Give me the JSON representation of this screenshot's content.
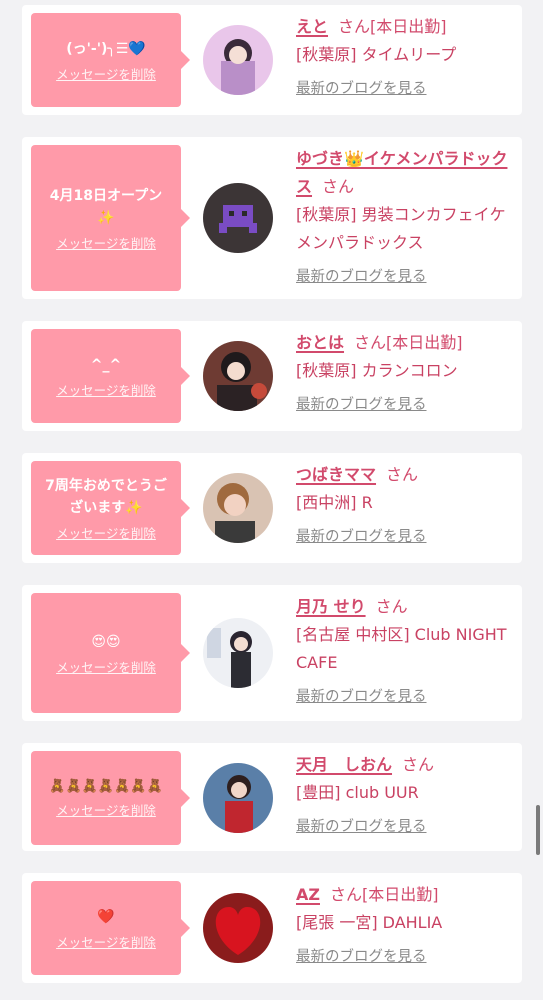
{
  "colors": {
    "accent": "#d24a6c",
    "bubble": "#ff9aa9",
    "link_gray": "#8a8a8a",
    "background": "#f2f2f4"
  },
  "delete_label": "メッセージを削除",
  "blog_label": "最新のブログを見る",
  "entries": [
    {
      "message": "(っ'-')╮☰💙",
      "name": "えと",
      "honor": "さん[本日出勤]",
      "shop": "[秋葉原] タイムリープ"
    },
    {
      "message": "4月18日オープン\n✨",
      "name": "ゆづき👑イケメンパラドックス",
      "honor": "さん",
      "shop": "[秋葉原] 男装コンカフェイケメンパラドックス"
    },
    {
      "message": "^_^",
      "name": "おとは",
      "honor": "さん[本日出勤]",
      "shop": "[秋葉原] カランコロン"
    },
    {
      "message": "7周年おめでとうございます✨",
      "name": "つばきママ",
      "honor": "さん",
      "shop": "[西中洲] R"
    },
    {
      "message": "😍😍",
      "name": "月乃 せり",
      "honor": "さん",
      "shop": "[名古屋 中村区] Club NIGHT CAFE"
    },
    {
      "message": "🧸🧸🧸🧸🧸🧸🧸",
      "name": "天月　しおん",
      "honor": "さん",
      "shop": "[豊田] club UUR"
    },
    {
      "message": "❤️",
      "name": "AZ",
      "honor": "さん[本日出勤]",
      "shop": "[尾張 一宮] DAHLIA"
    }
  ]
}
